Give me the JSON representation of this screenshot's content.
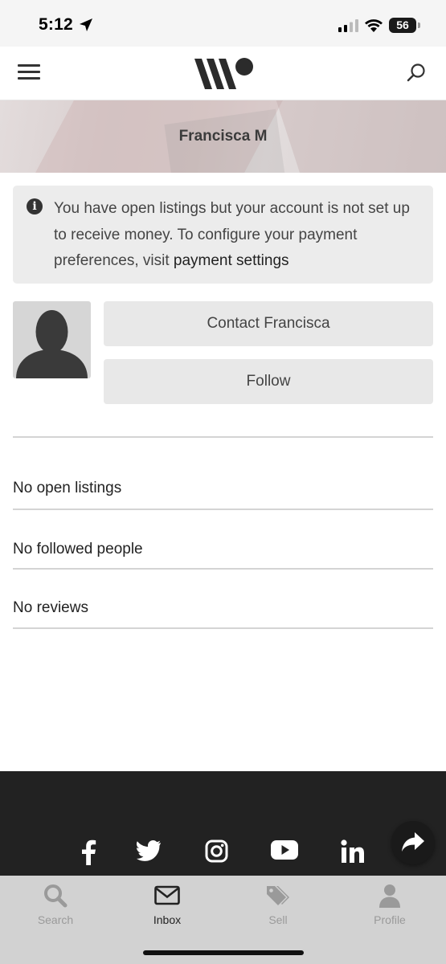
{
  "status_bar": {
    "time": "5:12",
    "battery": "56"
  },
  "profile": {
    "name": "Francisca M",
    "notice_text": "You have open listings but your account is not set up to receive money. To configure your payment preferences, visit ",
    "notice_link": "payment settings",
    "contact_button": "Contact Francisca",
    "follow_button": "Follow"
  },
  "sections": {
    "listings": "No open listings",
    "followed": "No followed people",
    "reviews": "No reviews"
  },
  "footer": {
    "social": [
      "facebook",
      "twitter",
      "instagram",
      "youtube",
      "linkedin"
    ]
  },
  "tabs": [
    {
      "label": "Search",
      "icon": "search-icon",
      "active": false
    },
    {
      "label": "Inbox",
      "icon": "envelope-icon",
      "active": true
    },
    {
      "label": "Sell",
      "icon": "tag-icon",
      "active": false
    },
    {
      "label": "Profile",
      "icon": "person-icon",
      "active": false
    }
  ],
  "colors": {
    "footer_bg": "#222222",
    "tabbar_bg": "#d2d2d2",
    "button_bg": "#e8e8e8",
    "notice_bg": "#ececec"
  }
}
